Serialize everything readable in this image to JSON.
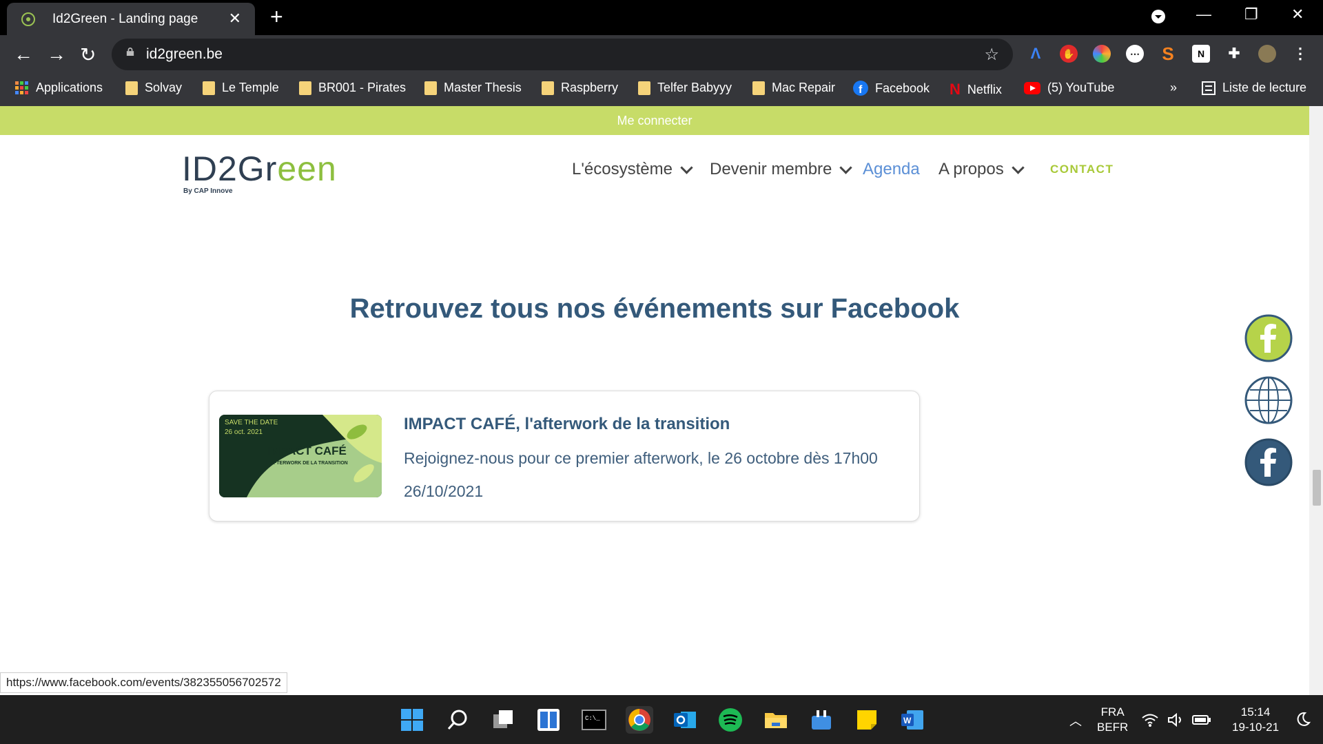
{
  "browser": {
    "tab_title": "Id2Green - Landing page",
    "url": "id2green.be",
    "bookmarks": [
      "Applications",
      "Solvay",
      "Le Temple",
      "BR001 - Pirates",
      "Master Thesis",
      "Raspberry",
      "Telfer Babyyy",
      "Mac Repair",
      "Facebook",
      "Netflix",
      "(5) YouTube"
    ],
    "more_bookmarks": "»",
    "reading_list": "Liste de lecture"
  },
  "site": {
    "topbar_link": "Me connecter",
    "logo_text_a": "ID2Gr",
    "logo_text_b": "een",
    "logo_by": "By CAP Innove",
    "nav": [
      "L'écosystème",
      "Devenir membre",
      "Agenda",
      "A propos"
    ],
    "contact": "CONTACT",
    "headline": "Retrouvez tous nos événements sur Facebook",
    "event": {
      "title": "IMPACT CAFÉ, l'afterwork de la transition",
      "description": "Rejoignez-nous pour ce premier afterwork, le 26 octobre dès 17h00",
      "date": "26/10/2021",
      "thumb_line1": "SAVE THE DATE",
      "thumb_line2": "26 oct. 2021",
      "thumb_title": "IMPACT CAFÉ",
      "thumb_sub": "L'AFTERWORK DE LA TRANSITION"
    }
  },
  "status_url": "https://www.facebook.com/events/382355056702572",
  "taskbar": {
    "lang_top": "FRA",
    "lang_bottom": "BEFR",
    "time": "15:14",
    "date": "19-10-21"
  },
  "colors": {
    "accent_green": "#c7dc68",
    "title_blue": "#34597a",
    "nav_active": "#5b8fd6"
  }
}
